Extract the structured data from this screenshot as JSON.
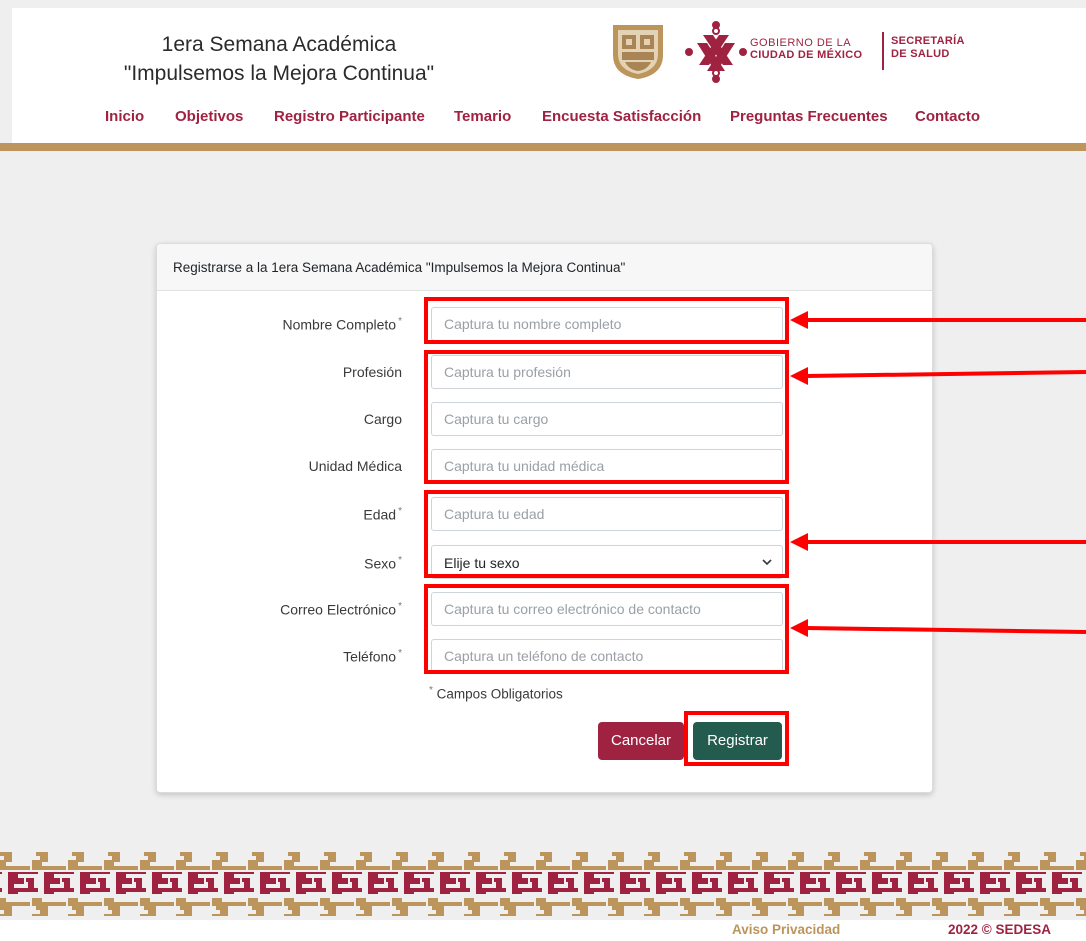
{
  "header": {
    "title_line1": "1era Semana Académica",
    "title_line2": "\"Impulsemos la Mejora Continua\"",
    "gobierno_line1": "GOBIERNO DE LA",
    "gobierno_line2": "CIUDAD DE MÉXICO",
    "secretaria_line1": "SECRETARÍA",
    "secretaria_line2": "DE SALUD",
    "icons": [
      "coat-of-arms-icon",
      "cdmx-logo-icon"
    ]
  },
  "nav": {
    "items": [
      {
        "label": "Inicio"
      },
      {
        "label": "Objetivos"
      },
      {
        "label": "Registro Participante"
      },
      {
        "label": "Temario"
      },
      {
        "label": "Encuesta Satisfacción"
      },
      {
        "label": "Preguntas Frecuentes"
      },
      {
        "label": "Contacto"
      }
    ]
  },
  "form": {
    "title": "Registrarse a la 1era Semana Académica \"Impulsemos la Mejora Continua\"",
    "required_marker": "*",
    "fields": [
      {
        "label": "Nombre Completo",
        "required": true,
        "placeholder": "Captura tu nombre completo",
        "value": ""
      },
      {
        "label": "Profesión",
        "required": false,
        "placeholder": "Captura tu profesión",
        "value": ""
      },
      {
        "label": "Cargo",
        "required": false,
        "placeholder": "Captura tu cargo",
        "value": ""
      },
      {
        "label": "Unidad Médica",
        "required": false,
        "placeholder": "Captura tu unidad médica",
        "value": ""
      },
      {
        "label": "Edad",
        "required": true,
        "placeholder": "Captura tu edad",
        "value": ""
      },
      {
        "label": "Sexo",
        "required": true,
        "selected": "Elije tu sexo"
      },
      {
        "label": "Correo Electrónico",
        "required": true,
        "placeholder": "Captura tu correo electrónico de contacto",
        "value": ""
      },
      {
        "label": "Teléfono",
        "required": true,
        "placeholder": "Captura un teléfono de contacto",
        "value": ""
      }
    ],
    "required_note": "Campos Obligatorios",
    "cancel_label": "Cancelar",
    "register_label": "Registrar"
  },
  "footer": {
    "aviso": "Aviso Privacidad",
    "copyright": "2022 © SEDESA"
  },
  "colors": {
    "brand_primary": "#9f2241",
    "brand_gold": "#bc955c",
    "brand_green": "#235b4e",
    "annotation_red": "#ff0000"
  }
}
